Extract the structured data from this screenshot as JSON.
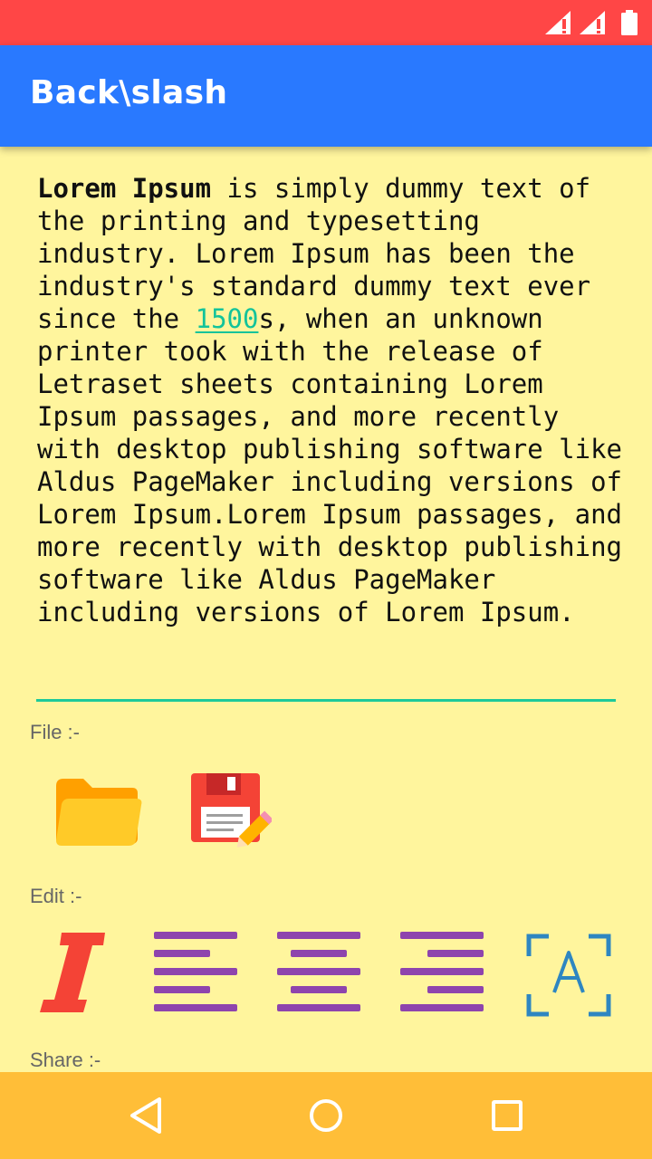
{
  "app": {
    "title": "Back\\slash"
  },
  "status_bar": {
    "icons": [
      "signal-no-data-icon",
      "signal-no-data-icon",
      "battery-icon"
    ],
    "background_color": "#FF4646"
  },
  "theme": {
    "app_bar_color": "#2979FF",
    "background_color": "#FFF59D",
    "nav_bar_color": "#FFBE38",
    "accent_color": "#1DC99A"
  },
  "editor": {
    "bold_lead": "Lorem Ipsum",
    "text_before_link": " is simply dummy text of the printing and typesetting industry. Lorem Ipsum has been the industry's standard dummy text ever since the ",
    "link_text": "1500",
    "text_after_link": "s, when an unknown printer took with the release of Letraset sheets containing Lorem Ipsum passages, and more recently with desktop publishing software like Aldus PageMaker including versions of Lorem Ipsum.Lorem Ipsum passages, and more recently with desktop publishing software like Aldus PageMaker including versions of Lorem Ipsum."
  },
  "sections": {
    "file_label": "File :-",
    "edit_label": "Edit :-",
    "share_label": "Share :-"
  },
  "file_tools": [
    "open-folder-icon",
    "save-floppy-icon"
  ],
  "edit_tools": [
    "italic-icon",
    "align-left-icon",
    "align-center-icon",
    "align-right-icon",
    "text-select-icon"
  ],
  "nav": [
    "back-icon",
    "home-icon",
    "recents-icon"
  ]
}
